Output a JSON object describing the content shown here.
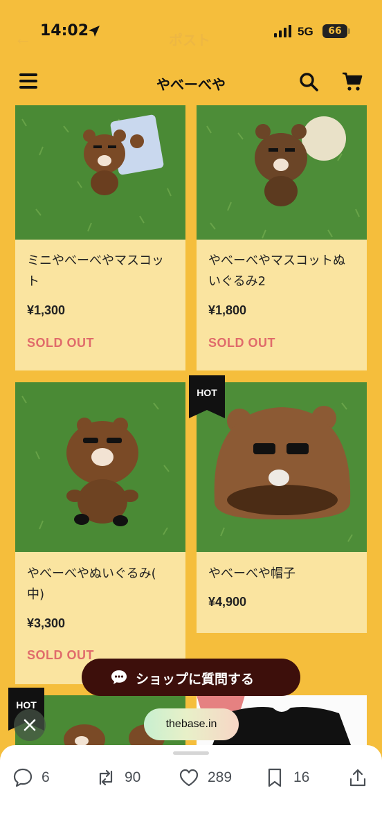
{
  "status_bar": {
    "time": "14:02",
    "network": "5G",
    "battery": "66",
    "ghost_back": "←",
    "ghost_title": "ポスト"
  },
  "header": {
    "title": "やべーべや"
  },
  "products": [
    {
      "name_line1": "ミニやべーべやマスコッ",
      "name_line2": "ト",
      "price": "¥1,300",
      "status": "SOLD OUT",
      "hot": false
    },
    {
      "name_line1": "やべーべやマスコットぬ",
      "name_line2": "いぐるみ2",
      "price": "¥1,800",
      "status": "SOLD OUT",
      "hot": false
    },
    {
      "name_line1": "やべーべやぬいぐるみ(",
      "name_line2": "中)",
      "price": "¥3,300",
      "status": "SOLD OUT",
      "hot": false
    },
    {
      "name_line1": "やべーべや帽子",
      "name_line2": "",
      "price": "¥4,900",
      "status": "",
      "hot": true,
      "badge": "HOT"
    }
  ],
  "partial_row": {
    "left_badge": "HOT"
  },
  "chat_button": {
    "label": "ショップに質問する",
    "icon": "speech-bubble-icon"
  },
  "link_pill": {
    "text": "thebase.in"
  },
  "actions": {
    "replies": "6",
    "reposts": "90",
    "likes": "289",
    "bookmarks": "16"
  },
  "colors": {
    "page_bg": "#f5be3c",
    "card_bg": "#fae4a0",
    "sold_out": "#e06b6b",
    "chat_button_bg": "#3d0f0b"
  }
}
